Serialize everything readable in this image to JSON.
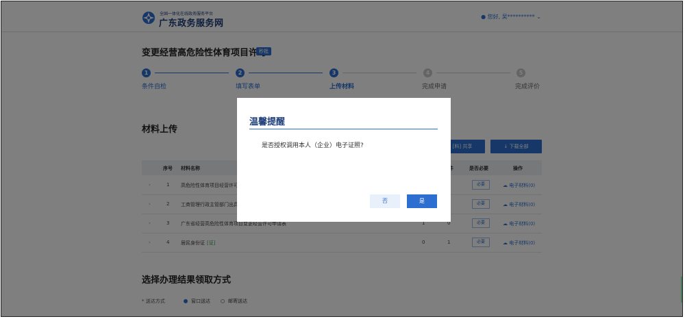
{
  "header": {
    "brand_top": "全国一体化在线政务服务平台",
    "brand_main": "广东政务服务网",
    "user_greeting": "您好, 吴**********"
  },
  "page": {
    "title": "变更经营高危险性体育项目许可",
    "badge": "秒批"
  },
  "steps": [
    {
      "num": "1",
      "label": "条件自检",
      "state": "done"
    },
    {
      "num": "2",
      "label": "填写表单",
      "state": "done"
    },
    {
      "num": "3",
      "label": "上传材料",
      "state": "active"
    },
    {
      "num": "4",
      "label": "完成申请",
      "state": "pending"
    },
    {
      "num": "5",
      "label": "完成评价",
      "state": "pending"
    }
  ],
  "materials": {
    "section_title": "材料上传",
    "share_label": "[料] 共享",
    "download_all_label": "↓ 下载全部",
    "columns": {
      "index": "序号",
      "name": "材料名称",
      "count": "件",
      "required": "是否必要",
      "action": "操作"
    },
    "rows": [
      {
        "index": "1",
        "name": "高危险性体育项目经营许可",
        "count": "",
        "count2": "",
        "required": "必要",
        "action": "电子材料(0)"
      },
      {
        "index": "2",
        "name": "工商管理行政主管部门出具",
        "count": "",
        "count2": "",
        "required": "必要",
        "action": "电子材料(0)"
      },
      {
        "index": "3",
        "name": "广东省经营高危险性体育项目变更经营许可申请表",
        "count": "1",
        "count2": "0",
        "required": "必要",
        "action": "电子材料(0)"
      },
      {
        "index": "4",
        "name": "居民身份证",
        "tag": "[证]",
        "count": "0",
        "count2": "1",
        "required": "必要",
        "action": "电子材料(0)"
      }
    ]
  },
  "delivery": {
    "section_title": "选择办理结果领取方式",
    "label": "* 送达方式",
    "options": [
      "窗口送达",
      "邮寄送达"
    ],
    "selected": "窗口送达"
  },
  "modal": {
    "title": "温馨提醒",
    "message": "是否授权调用本人（企业）电子证照?",
    "no_label": "否",
    "yes_label": "是"
  },
  "colors": {
    "primary": "#2d6fd0",
    "brand": "#1d3e7a",
    "overlay": "rgba(0,0,0,0.5)"
  }
}
